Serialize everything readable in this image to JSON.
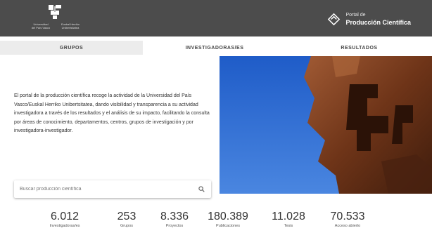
{
  "header": {
    "logo": {
      "text_left_1": "Universidad",
      "text_left_2": "del País Vasco",
      "text_right_1": "Euskal Herriko",
      "text_right_2": "Unibertsitatea"
    },
    "portal_small": "Portal de",
    "portal_big": "Producción Científica"
  },
  "tabs": [
    {
      "label": "GRUPOS"
    },
    {
      "label": "INVESTIGADORAS/ES"
    },
    {
      "label": "RESULTADOS"
    }
  ],
  "intro_text": "El portal de la producción científica recoge la actividad de la Universidad del País Vasco/Euskal Herriko Unibertsitatea, dando visibilidad y transparencia a su actividad investigadora a través de los resultados y el análisis de su impacto, facilitando la consulta por áreas de conocimiento, departamentos, centros, grupos de investigación y por investigadora-investigador.",
  "search": {
    "placeholder": "Buscar producción científica"
  },
  "stats": [
    {
      "value": "6.012",
      "label": "Investigadoras/es"
    },
    {
      "value": "253",
      "label": "Grupos"
    },
    {
      "value": "8.336",
      "label": "Proyectos"
    },
    {
      "value": "180.389",
      "label": "Publicaciones"
    },
    {
      "value": "11.028",
      "label": "Tesis"
    },
    {
      "value": "70.533",
      "label": "Acceso abierto"
    }
  ],
  "colors": {
    "header_bg": "#4c4c4c",
    "sky": "#2f6bd0",
    "sculpture": "#7a3a1c"
  }
}
